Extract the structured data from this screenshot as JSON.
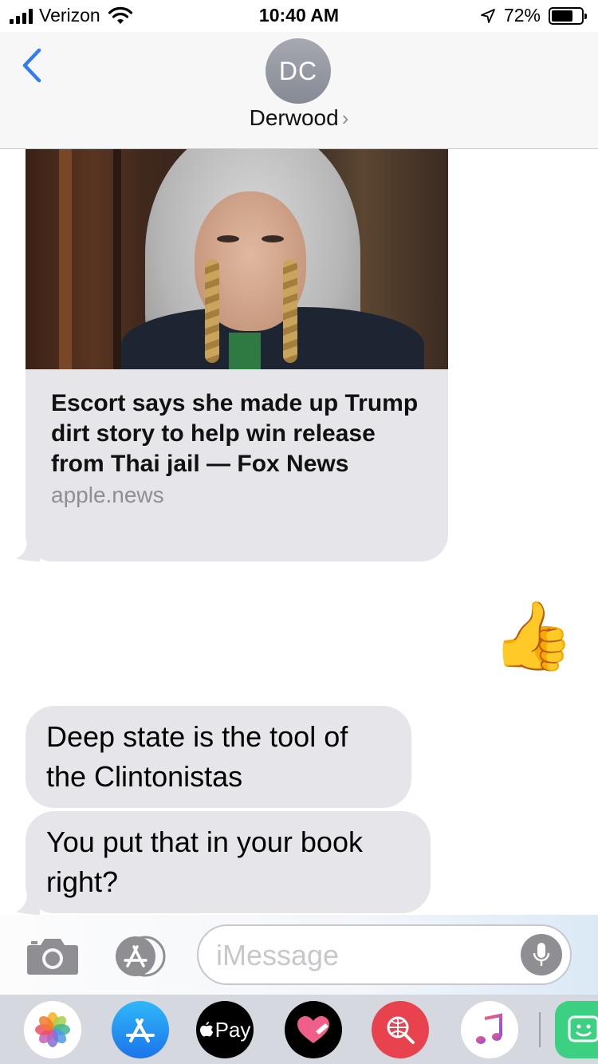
{
  "status_bar": {
    "carrier": "Verizon",
    "time": "10:40 AM",
    "battery_percent": "72%",
    "battery_level": 0.72,
    "icons": [
      "signal-bars-icon",
      "wifi-icon",
      "location-arrow-icon",
      "battery-icon"
    ]
  },
  "header": {
    "avatar_initials": "DC",
    "contact_name": "Derwood",
    "chevron": "›",
    "back_icon": "chevron-left-icon"
  },
  "messages": {
    "link_preview": {
      "title": "Escort says she made up Trump dirt story to help win release from Thai jail — Fox News",
      "domain": "apple.news"
    },
    "reaction_emoji": "👍",
    "bubble_1": "Deep state is the tool of the Clintonistas",
    "bubble_2": "You put that in your book right?"
  },
  "composer": {
    "placeholder": "iMessage",
    "icons": [
      "camera-icon",
      "app-store-icon",
      "microphone-icon"
    ]
  },
  "app_drawer": {
    "apple_pay_label": "Pay",
    "apple_logo": "",
    "apps": [
      "photos",
      "app-store",
      "apple-pay",
      "digital-touch",
      "images-search",
      "music",
      "stickers"
    ]
  },
  "colors": {
    "ios_blue": "#2f7cf6",
    "bubble_gray": "#e5e5ea",
    "secondary_text": "#8e8e93"
  }
}
